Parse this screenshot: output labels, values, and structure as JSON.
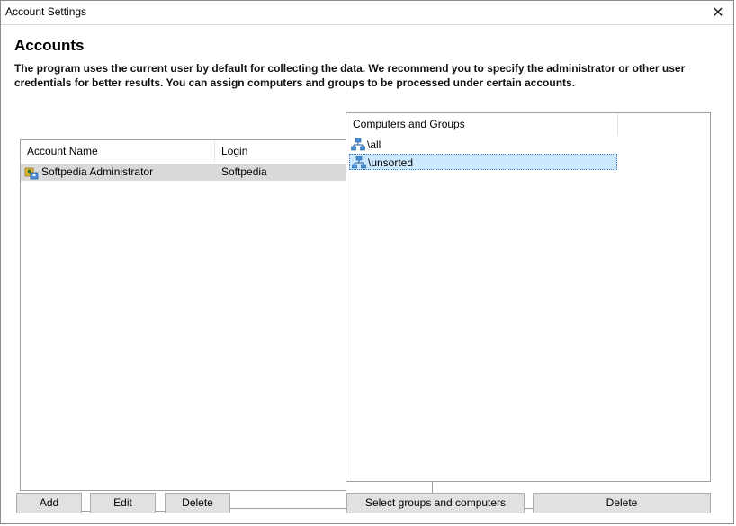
{
  "window": {
    "title": "Account Settings",
    "close_glyph": "✕"
  },
  "page": {
    "heading": "Accounts",
    "description": "The program uses the current user by default for collecting the data. We recommend you to specify the administrator or other user credentials for better results. You can assign computers and groups to be processed under certain accounts."
  },
  "accounts": {
    "columns": [
      "Account Name",
      "Login"
    ],
    "rows": [
      {
        "name": "Softpedia Administrator",
        "login": "Softpedia",
        "icon": "user-group-icon"
      }
    ]
  },
  "groups": {
    "column": "Computers and Groups",
    "items": [
      {
        "label": "\\all",
        "icon": "network-icon",
        "selected": false
      },
      {
        "label": "\\unsorted",
        "icon": "network-icon",
        "selected": true
      }
    ]
  },
  "buttons": {
    "add": "Add",
    "edit": "Edit",
    "delete_account": "Delete",
    "select_groups": "Select groups and computers",
    "delete_group": "Delete"
  },
  "colors": {
    "selection_bg": "#cce8ff",
    "row_highlight": "#d9d9d9",
    "button_bg": "#e1e1e1"
  }
}
